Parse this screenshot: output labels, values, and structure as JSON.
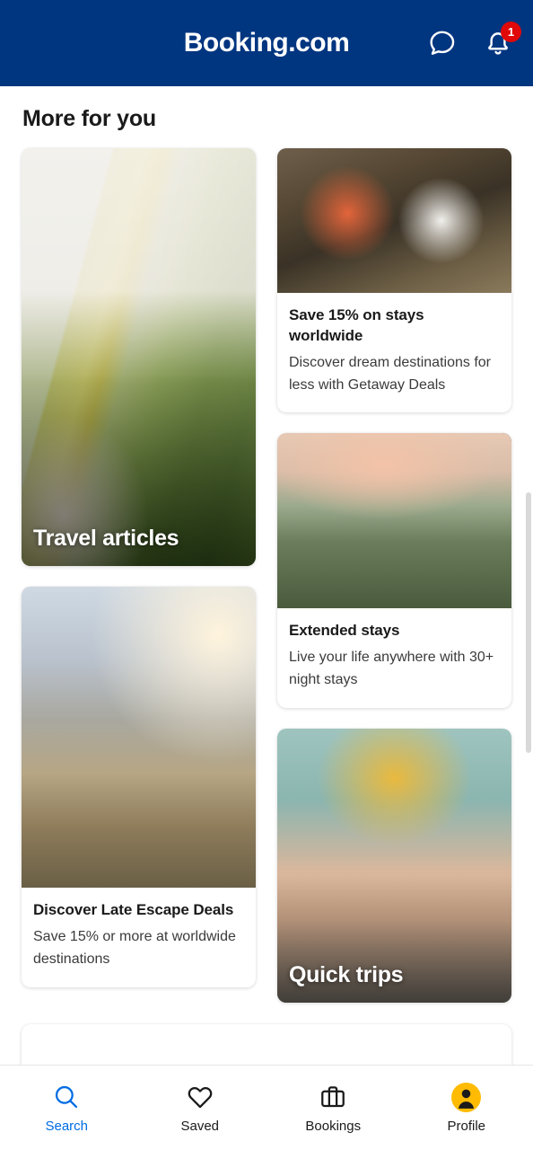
{
  "header": {
    "brand": "Booking.com",
    "chat_icon": "chat-bubble-icon",
    "bell_icon": "bell-icon",
    "notification_count": "1",
    "background_color": "#003580",
    "badge_color": "#e00808"
  },
  "main": {
    "page_title": "More for you"
  },
  "cards": {
    "travel_articles": {
      "overlay_title": "Travel articles",
      "photo": "campervan-forest-road-photo"
    },
    "save_15": {
      "title": "Save 15% on stays worldwide",
      "subtitle": "Discover dream destinations for less with Getaway Deals",
      "photo": "family-relaxing-outdoors-photo"
    },
    "extended_stays": {
      "title": "Extended stays",
      "subtitle": "Live your life anywhere with 30+ night stays",
      "photo": "woman-laptop-balcony-sunset-photo"
    },
    "late_escape": {
      "title": "Discover Late Escape Deals",
      "subtitle": "Save 15% or more at worldwide destinations",
      "photo": "hikers-mountain-trail-photo"
    },
    "quick_trips": {
      "overlay_title": "Quick trips",
      "photo": "person-packing-suitcase-photo"
    }
  },
  "bottom_nav": {
    "items": [
      {
        "label": "Search",
        "icon": "magnifier-icon",
        "active": true
      },
      {
        "label": "Saved",
        "icon": "heart-icon",
        "active": false
      },
      {
        "label": "Bookings",
        "icon": "briefcase-icon",
        "active": false
      },
      {
        "label": "Profile",
        "icon": "avatar-icon",
        "active": false
      }
    ],
    "active_color": "#006ce4",
    "avatar_color": "#febb02"
  }
}
